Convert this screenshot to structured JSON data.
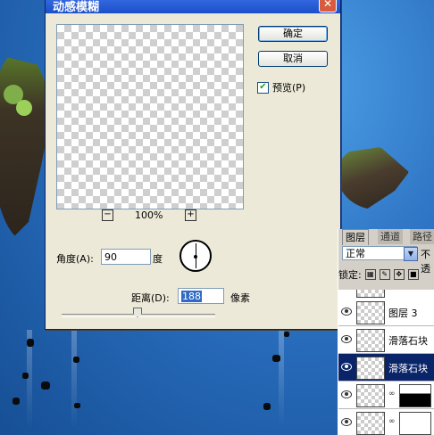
{
  "dialog": {
    "title": "动感模糊",
    "close_glyph": "✕",
    "ok_label": "确定",
    "cancel_label": "取消",
    "preview_label": "预览(P)",
    "preview_checked": true,
    "zoom_minus": "−",
    "zoom_plus": "+",
    "zoom_value": "100%",
    "angle_label": "角度(A):",
    "angle_value": "90",
    "angle_unit": "度",
    "distance_label": "距离(D):",
    "distance_value": "188",
    "distance_unit": "像素"
  },
  "layers_panel": {
    "tabs": [
      {
        "label": "图层",
        "active": true
      },
      {
        "label": "通道",
        "active": false
      },
      {
        "label": "路径",
        "active": false
      }
    ],
    "blend_mode": "正常",
    "opacity_label": "不透",
    "lock_label": "锁定:",
    "layers": [
      {
        "name": "",
        "selected": false
      },
      {
        "name": "图层 3",
        "selected": false
      },
      {
        "name": "滑落石块",
        "selected": false
      },
      {
        "name": "滑落石块",
        "selected": true
      },
      {
        "name": "",
        "selected": false,
        "has_mask": true
      },
      {
        "name": "",
        "selected": false,
        "has_mask": true
      }
    ]
  },
  "colors": {
    "dialog_bg": "#ece9d8",
    "titlebar": "#1c50c8",
    "selection": "#0a246a",
    "sky": "#2a6fc0"
  }
}
